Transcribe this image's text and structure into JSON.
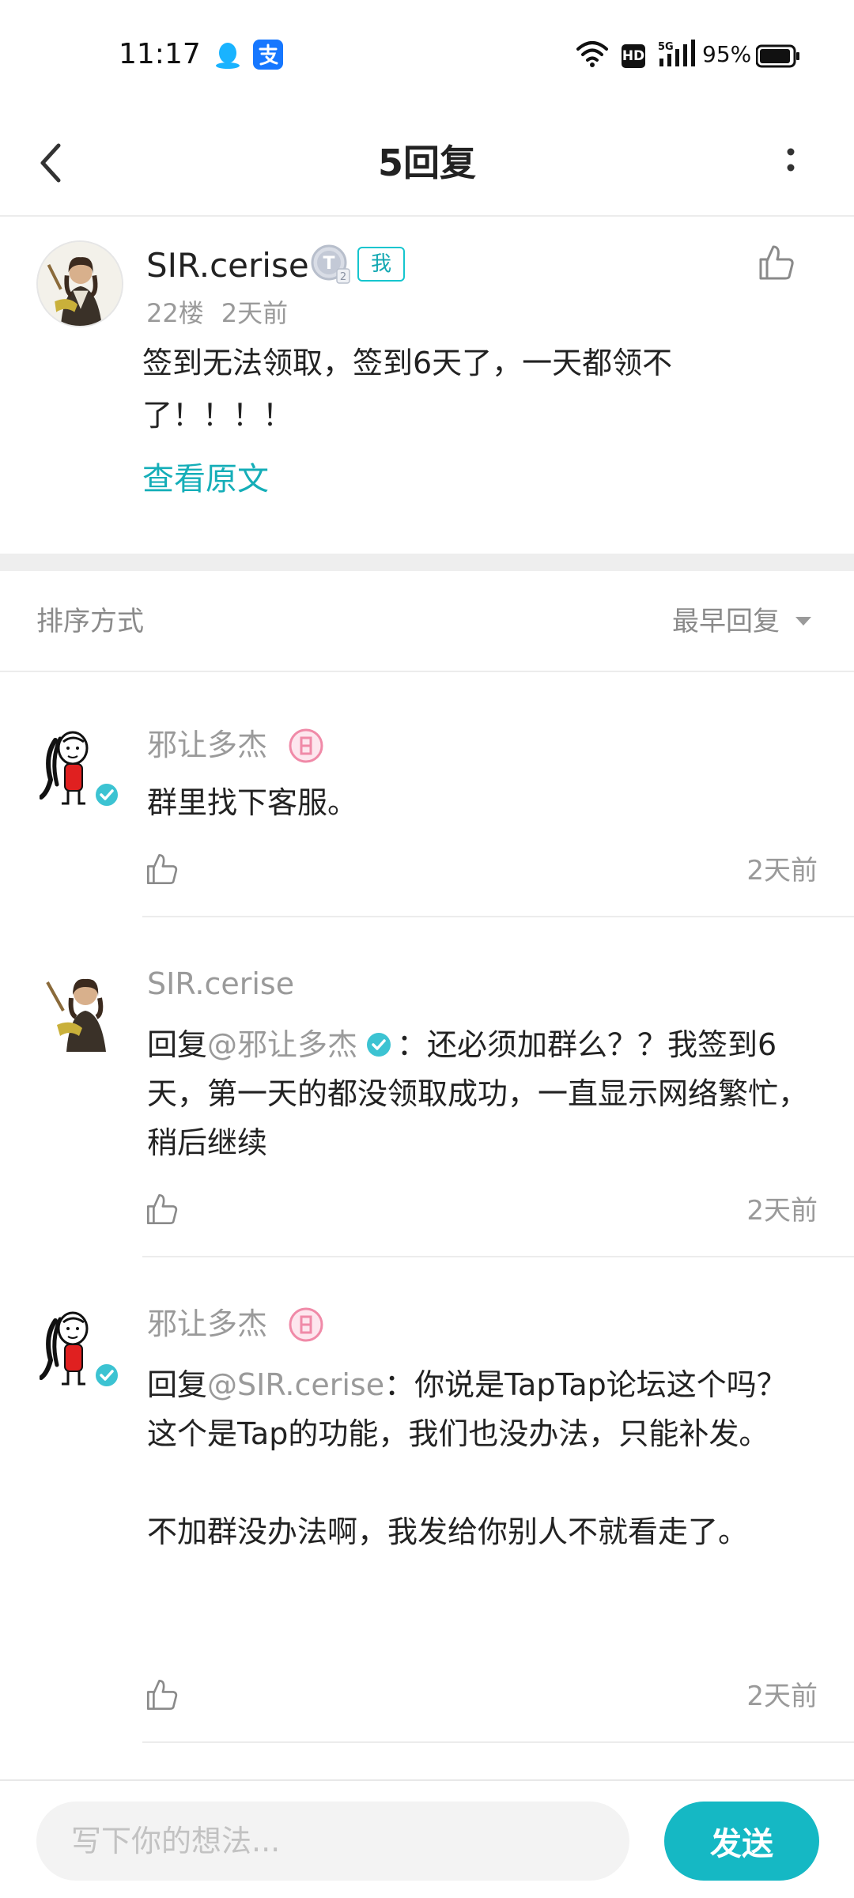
{
  "status_bar": {
    "time": "11:17",
    "battery": "95%",
    "hd": "HD",
    "network": "5G",
    "battery_level": 0.95
  },
  "header": {
    "title": "5回复"
  },
  "post": {
    "author": "SIR.cerise",
    "level": "2",
    "me_badge": "我",
    "floor": "22楼",
    "time": "2天前",
    "body": "签到无法领取，签到6天了，一天都领不了！！！！",
    "view_original": "查看原文"
  },
  "sort": {
    "label": "排序方式",
    "value": "最早回复"
  },
  "replies": [
    {
      "author": "邪让多杰",
      "body": "群里找下客服。",
      "time": "2天前"
    },
    {
      "author": "SIR.cerise",
      "reply_prefix": "回复",
      "mention": "@邪让多杰",
      "body": "：还必须加群么？？我签到6天，第一天的都没领取成功，一直显示网络繁忙，稍后继续",
      "time": "2天前"
    },
    {
      "author": "邪让多杰",
      "reply_prefix": "回复",
      "mention": "@SIR.cerise",
      "body": "：你说是TapTap论坛这个吗？\n这个是Tap的功能，我们也没办法，只能补发。\n\n不加群没办法啊，我发给你别人不就看走了。",
      "time": "2天前"
    }
  ],
  "composer": {
    "placeholder": "写下你的想法...",
    "send_label": "发送"
  },
  "colors": {
    "accent": "#15b8c4",
    "link": "#15aeb8",
    "muted": "#9a9a9a",
    "text": "#222222"
  },
  "icons": [
    "qq-icon",
    "alipay-icon",
    "wifi-icon",
    "signal-icon",
    "battery-icon",
    "back-icon",
    "more-icon",
    "like-icon",
    "verified-icon",
    "level-badge-icon",
    "caret-down-icon"
  ]
}
